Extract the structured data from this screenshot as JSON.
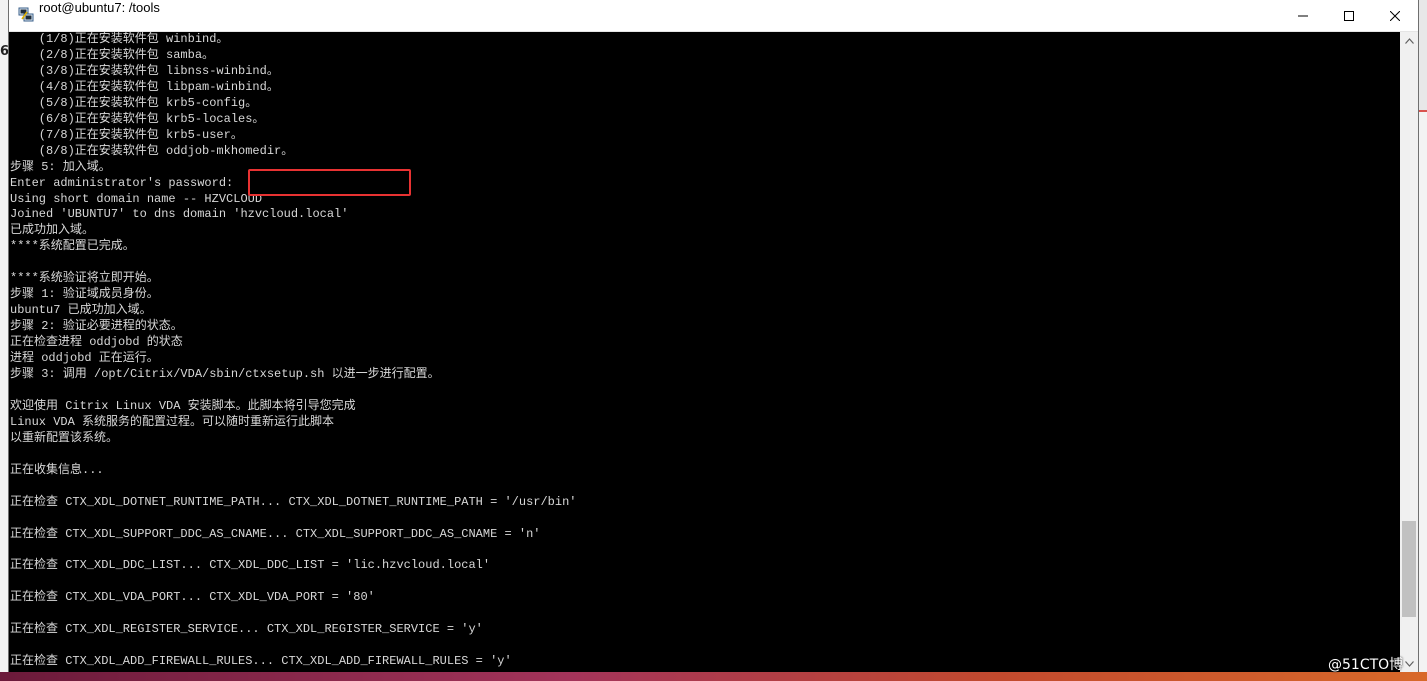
{
  "window": {
    "title": "root@ubuntu7: /tools",
    "minimize_icon": "minimize-icon",
    "maximize_icon": "maximize-icon",
    "close_icon": "close-icon"
  },
  "desktop": {
    "left_mark": "6"
  },
  "terminal": {
    "lines": [
      "    (1/8)正在安装软件包 winbind。",
      "    (2/8)正在安装软件包 samba。",
      "    (3/8)正在安装软件包 libnss-winbind。",
      "    (4/8)正在安装软件包 libpam-winbind。",
      "    (5/8)正在安装软件包 krb5-config。",
      "    (6/8)正在安装软件包 krb5-locales。",
      "    (7/8)正在安装软件包 krb5-user。",
      "    (8/8)正在安装软件包 oddjob-mkhomedir。",
      "步骤 5: 加入域。",
      "Enter administrator's password:",
      "Using short domain name -- HZVCLOUD",
      "Joined 'UBUNTU7' to dns domain 'hzvcloud.local'",
      "已成功加入域。",
      "****系统配置已完成。",
      "",
      "****系统验证将立即开始。",
      "步骤 1: 验证域成员身份。",
      "ubuntu7 已成功加入域。",
      "步骤 2: 验证必要进程的状态。",
      "正在检查进程 oddjobd 的状态",
      "进程 oddjobd 正在运行。",
      "步骤 3: 调用 /opt/Citrix/VDA/sbin/ctxsetup.sh 以进一步进行配置。",
      "",
      "欢迎使用 Citrix Linux VDA 安装脚本。此脚本将引导您完成",
      "Linux VDA 系统服务的配置过程。可以随时重新运行此脚本",
      "以重新配置该系统。",
      "",
      "正在收集信息...",
      "",
      "正在检查 CTX_XDL_DOTNET_RUNTIME_PATH... CTX_XDL_DOTNET_RUNTIME_PATH = '/usr/bin'",
      "",
      "正在检查 CTX_XDL_SUPPORT_DDC_AS_CNAME... CTX_XDL_SUPPORT_DDC_AS_CNAME = 'n'",
      "",
      "正在检查 CTX_XDL_DDC_LIST... CTX_XDL_DDC_LIST = 'lic.hzvcloud.local'",
      "",
      "正在检查 CTX_XDL_VDA_PORT... CTX_XDL_VDA_PORT = '80'",
      "",
      "正在检查 CTX_XDL_REGISTER_SERVICE... CTX_XDL_REGISTER_SERVICE = 'y'",
      "",
      "正在检查 CTX_XDL_ADD_FIREWALL_RULES... CTX_XDL_ADD_FIREWALL_RULES = 'y'"
    ]
  },
  "watermark": "@51CTO博",
  "colors": {
    "terminal_bg": "#000000",
    "terminal_fg": "#d8d8d8",
    "highlight": "#e83232"
  }
}
